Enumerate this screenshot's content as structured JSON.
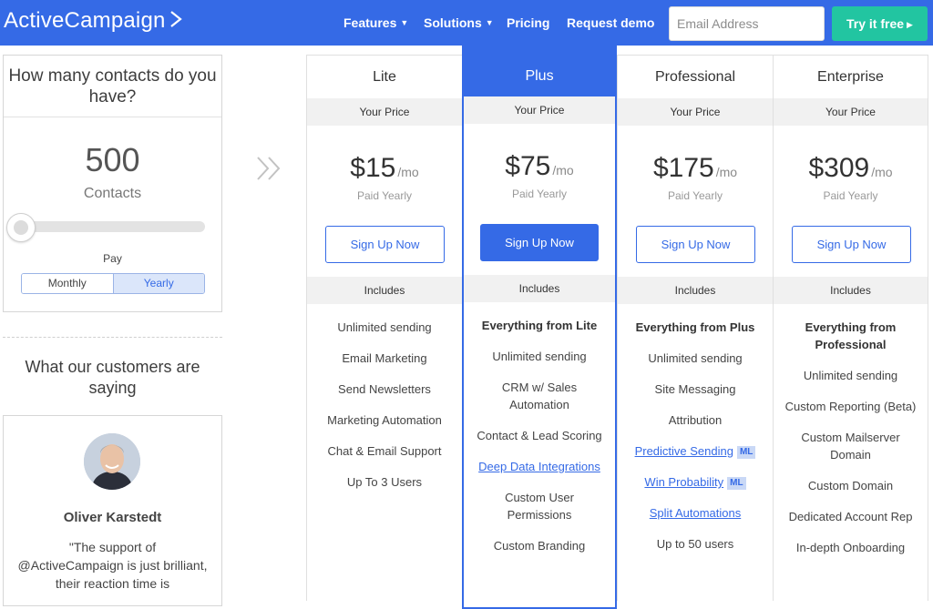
{
  "header": {
    "logo": "ActiveCampaign",
    "nav": [
      {
        "label": "Features",
        "dropdown": true
      },
      {
        "label": "Solutions",
        "dropdown": true
      },
      {
        "label": "Pricing",
        "dropdown": false
      },
      {
        "label": "Request demo",
        "dropdown": false
      }
    ],
    "email_placeholder": "Email Address",
    "cta_label": "Try it free",
    "brand_color": "#356ae6",
    "cta_color": "#22c5a1"
  },
  "contacts": {
    "question": "How many contacts do you have?",
    "count": "500",
    "count_label": "Contacts",
    "slider_position": 0,
    "pay_label": "Pay",
    "billing_options": [
      "Monthly",
      "Yearly"
    ],
    "billing_selected": "Yearly"
  },
  "customers": {
    "title": "What our customers are saying",
    "name": "Oliver Karstedt",
    "quote": "\"The support of @ActiveCampaign is just brilliant, their reaction time is"
  },
  "common": {
    "your_price": "Your Price",
    "per": "/mo",
    "paid": "Paid Yearly",
    "signup": "Sign Up Now",
    "includes": "Includes",
    "ml_badge": "ML"
  },
  "plans": [
    {
      "name": "Lite",
      "price": "$15",
      "features": [
        {
          "text": "Unlimited sending"
        },
        {
          "text": "Email Marketing"
        },
        {
          "text": "Send Newsletters"
        },
        {
          "text": "Marketing Automation"
        },
        {
          "text": "Chat & Email Support"
        },
        {
          "text": "Up To 3 Users"
        }
      ]
    },
    {
      "name": "Plus",
      "price": "$75",
      "features": [
        {
          "text": "Everything from Lite",
          "bold": true
        },
        {
          "text": "Unlimited sending"
        },
        {
          "text": "CRM w/ Sales Automation"
        },
        {
          "text": "Contact & Lead Scoring"
        },
        {
          "text": "Deep Data Integrations",
          "link": true
        },
        {
          "text": "Custom User Permissions"
        },
        {
          "text": "Custom Branding"
        }
      ]
    },
    {
      "name": "Professional",
      "price": "$175",
      "features": [
        {
          "text": "Everything from Plus",
          "bold": true
        },
        {
          "text": "Unlimited sending"
        },
        {
          "text": "Site Messaging"
        },
        {
          "text": "Attribution"
        },
        {
          "text": "Predictive Sending",
          "link": true,
          "ml": true
        },
        {
          "text": "Win Probability",
          "link": true,
          "ml": true
        },
        {
          "text": "Split Automations",
          "link": true
        },
        {
          "text": "Up to 50 users"
        }
      ]
    },
    {
      "name": "Enterprise",
      "price": "$309",
      "features": [
        {
          "text": "Everything from Professional",
          "bold": true
        },
        {
          "text": "Unlimited sending"
        },
        {
          "text": "Custom Reporting (Beta)"
        },
        {
          "text": "Custom Mailserver Domain"
        },
        {
          "text": "Custom Domain"
        },
        {
          "text": "Dedicated Account Rep"
        },
        {
          "text": "In-depth Onboarding"
        }
      ]
    }
  ]
}
